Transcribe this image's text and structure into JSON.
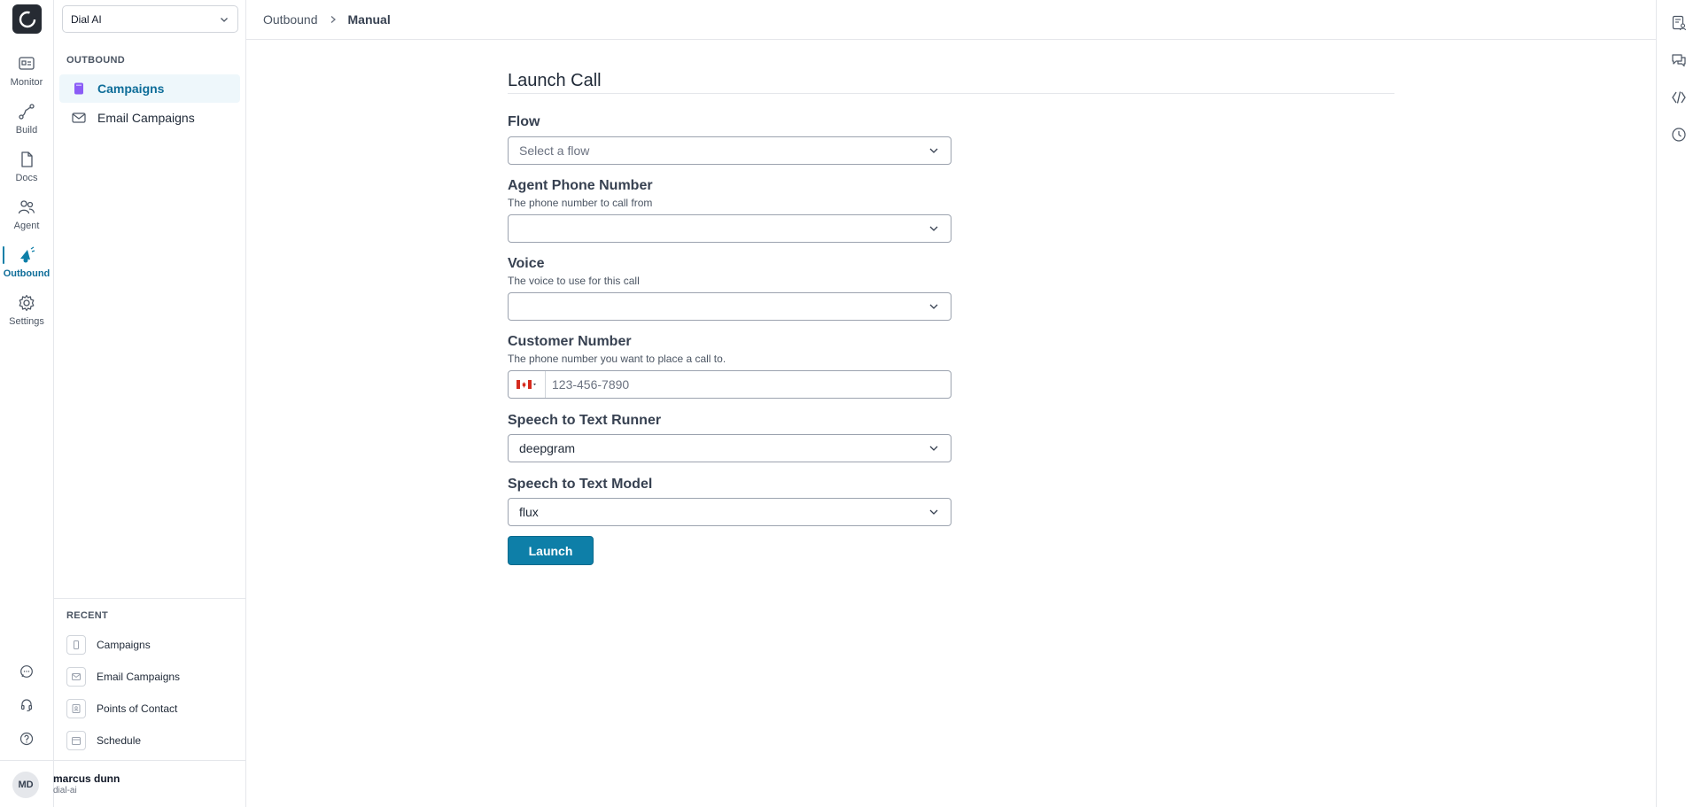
{
  "workspace": {
    "name": "Dial AI"
  },
  "rail": {
    "items": [
      {
        "label": "Monitor",
        "icon": "monitor-icon"
      },
      {
        "label": "Build",
        "icon": "build-icon"
      },
      {
        "label": "Docs",
        "icon": "docs-icon"
      },
      {
        "label": "Agent",
        "icon": "agent-icon"
      },
      {
        "label": "Outbound",
        "icon": "outbound-icon",
        "active": true
      },
      {
        "label": "Settings",
        "icon": "settings-icon"
      }
    ],
    "bottom_icons": [
      "chat-icon",
      "support-icon",
      "help-icon"
    ]
  },
  "sidebar": {
    "section_label": "OUTBOUND",
    "items": [
      {
        "label": "Campaigns",
        "icon": "campaign-icon",
        "active": true
      },
      {
        "label": "Email Campaigns",
        "icon": "email-icon"
      }
    ],
    "recent_label": "RECENT",
    "recent": [
      {
        "label": "Campaigns",
        "icon": "campaign-icon"
      },
      {
        "label": "Email Campaigns",
        "icon": "email-icon"
      },
      {
        "label": "Points of Contact",
        "icon": "contact-icon"
      },
      {
        "label": "Schedule",
        "icon": "calendar-icon"
      }
    ]
  },
  "user": {
    "initials": "MD",
    "name": "marcus dunn",
    "org": "dial-ai"
  },
  "breadcrumb": {
    "parent": "Outbound",
    "current": "Manual"
  },
  "form": {
    "title": "Launch Call",
    "flow": {
      "label": "Flow",
      "placeholder": "Select a flow"
    },
    "agent_phone": {
      "label": "Agent Phone Number",
      "help": "The phone number to call from",
      "value": ""
    },
    "voice": {
      "label": "Voice",
      "help": "The voice to use for this call",
      "value": ""
    },
    "customer_number": {
      "label": "Customer Number",
      "help": "The phone number you want to place a call to.",
      "placeholder": "123-456-7890",
      "country": "CA"
    },
    "stt_runner": {
      "label": "Speech to Text Runner",
      "value": "deepgram"
    },
    "stt_model": {
      "label": "Speech to Text Model",
      "value": "flux"
    },
    "launch_label": "Launch"
  },
  "colors": {
    "accent": "#0e7fa8",
    "active_bg": "#eef7fb",
    "active_text": "#0e6d99"
  }
}
